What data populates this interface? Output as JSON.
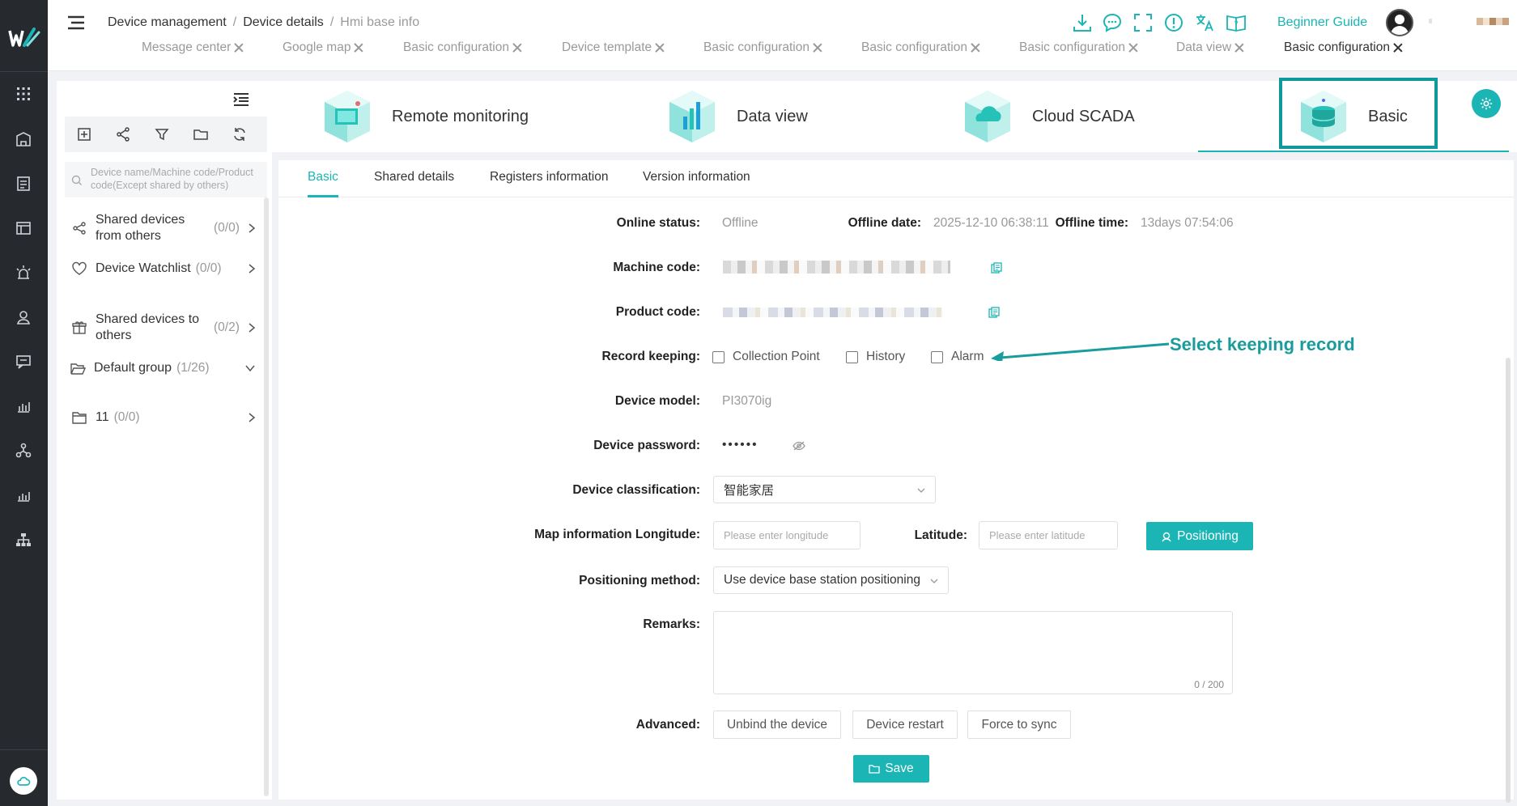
{
  "colors": {
    "accent": "#1bb5b5",
    "sidebar": "#262a2f",
    "annotation": "#1a9c9c"
  },
  "header": {
    "breadcrumb": [
      "Device management",
      "Device details",
      "Hmi base info"
    ],
    "beginner_guide": "Beginner Guide",
    "icons": [
      "download-icon",
      "chat-icon",
      "fullscreen-icon",
      "alert-icon",
      "translate-icon",
      "help-book-icon"
    ]
  },
  "open_tabs": [
    {
      "label": "Message center"
    },
    {
      "label": "Google map"
    },
    {
      "label": "Basic configuration"
    },
    {
      "label": "Device template"
    },
    {
      "label": "Basic configuration"
    },
    {
      "label": "Basic configuration"
    },
    {
      "label": "Basic configuration"
    },
    {
      "label": "Data view"
    },
    {
      "label": "Basic configuration"
    }
  ],
  "left_panel": {
    "search_placeholder": "Device name/Machine code/Product code(Except shared by others)",
    "items": [
      {
        "label": "Shared devices from others",
        "count": "(0/0)"
      },
      {
        "label": "Device Watchlist",
        "count": "(0/0)"
      },
      {
        "label": "Shared devices to others",
        "count": "(0/2)"
      },
      {
        "label": "Default group",
        "count": "(1/26)"
      },
      {
        "label": "11",
        "count": "(0/0)"
      }
    ]
  },
  "top_cards": [
    {
      "label": "Remote monitoring"
    },
    {
      "label": "Data view"
    },
    {
      "label": "Cloud SCADA"
    },
    {
      "label": "Basic"
    }
  ],
  "sub_tabs": [
    "Basic",
    "Shared details",
    "Registers information",
    "Version information"
  ],
  "form": {
    "online_status": {
      "label": "Online status:",
      "value": "Offline"
    },
    "offline_date": {
      "label": "Offline date:",
      "value": "2025-12-10 06:38:11"
    },
    "offline_time": {
      "label": "Offline time:",
      "value": "13days 07:54:06"
    },
    "machine_code": {
      "label": "Machine code:"
    },
    "product_code": {
      "label": "Product code:"
    },
    "record_keeping": {
      "label": "Record keeping:",
      "options": [
        "Collection Point",
        "History",
        "Alarm"
      ]
    },
    "device_model": {
      "label": "Device model:",
      "value": "PI3070ig"
    },
    "device_password": {
      "label": "Device password:",
      "value": "••••••"
    },
    "device_classification": {
      "label": "Device classification:",
      "value": "智能家居"
    },
    "longitude": {
      "label": "Map information Longitude:",
      "placeholder": "Please enter longitude"
    },
    "latitude": {
      "label": "Latitude:",
      "placeholder": "Please enter latitude"
    },
    "positioning_button": "Positioning",
    "positioning_method": {
      "label": "Positioning method:",
      "value": "Use device base station positioning"
    },
    "remarks": {
      "label": "Remarks:",
      "counter": "0 / 200"
    },
    "advanced": {
      "label": "Advanced:",
      "buttons": [
        "Unbind the device",
        "Device restart",
        "Force to sync"
      ]
    },
    "save_button": "Save"
  },
  "annotation": "Select keeping record"
}
